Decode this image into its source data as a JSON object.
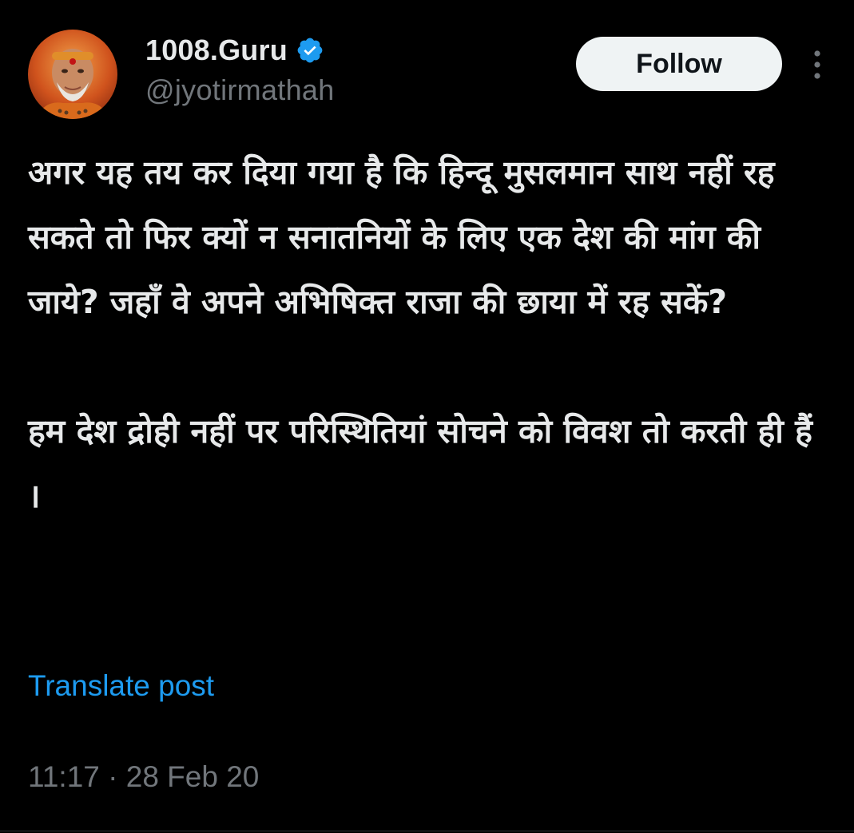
{
  "author": {
    "display_name": "1008.Guru",
    "handle": "@jyotirmathah",
    "verified": true
  },
  "follow_button": {
    "label": "Follow"
  },
  "tweet": {
    "paragraph1": "अगर यह तय कर दिया गया है कि हिन्दू मुसलमान साथ नहीं रह सकते तो फिर क्यों न सनातनियों के लिए एक देश की मांग की जाये? जहाँ वे अपने अभिषिक्त राजा की छाया में रह सकें?",
    "paragraph2": "हम देश द्रोही नहीं पर परिस्थितियां सोचने को विवश तो करती ही हैं ।"
  },
  "translate": {
    "label": "Translate post"
  },
  "meta": {
    "time": "11:17",
    "separator": "·",
    "date": "28 Feb 20"
  },
  "colors": {
    "background": "#000000",
    "primary_text": "#e7e9ea",
    "secondary_text": "#71767b",
    "link": "#1d9bf0",
    "verified_badge": "#1d9bf0",
    "follow_bg": "#eff3f4"
  },
  "icons": {
    "verified": "verified-badge-icon",
    "more": "more-vertical-icon"
  }
}
